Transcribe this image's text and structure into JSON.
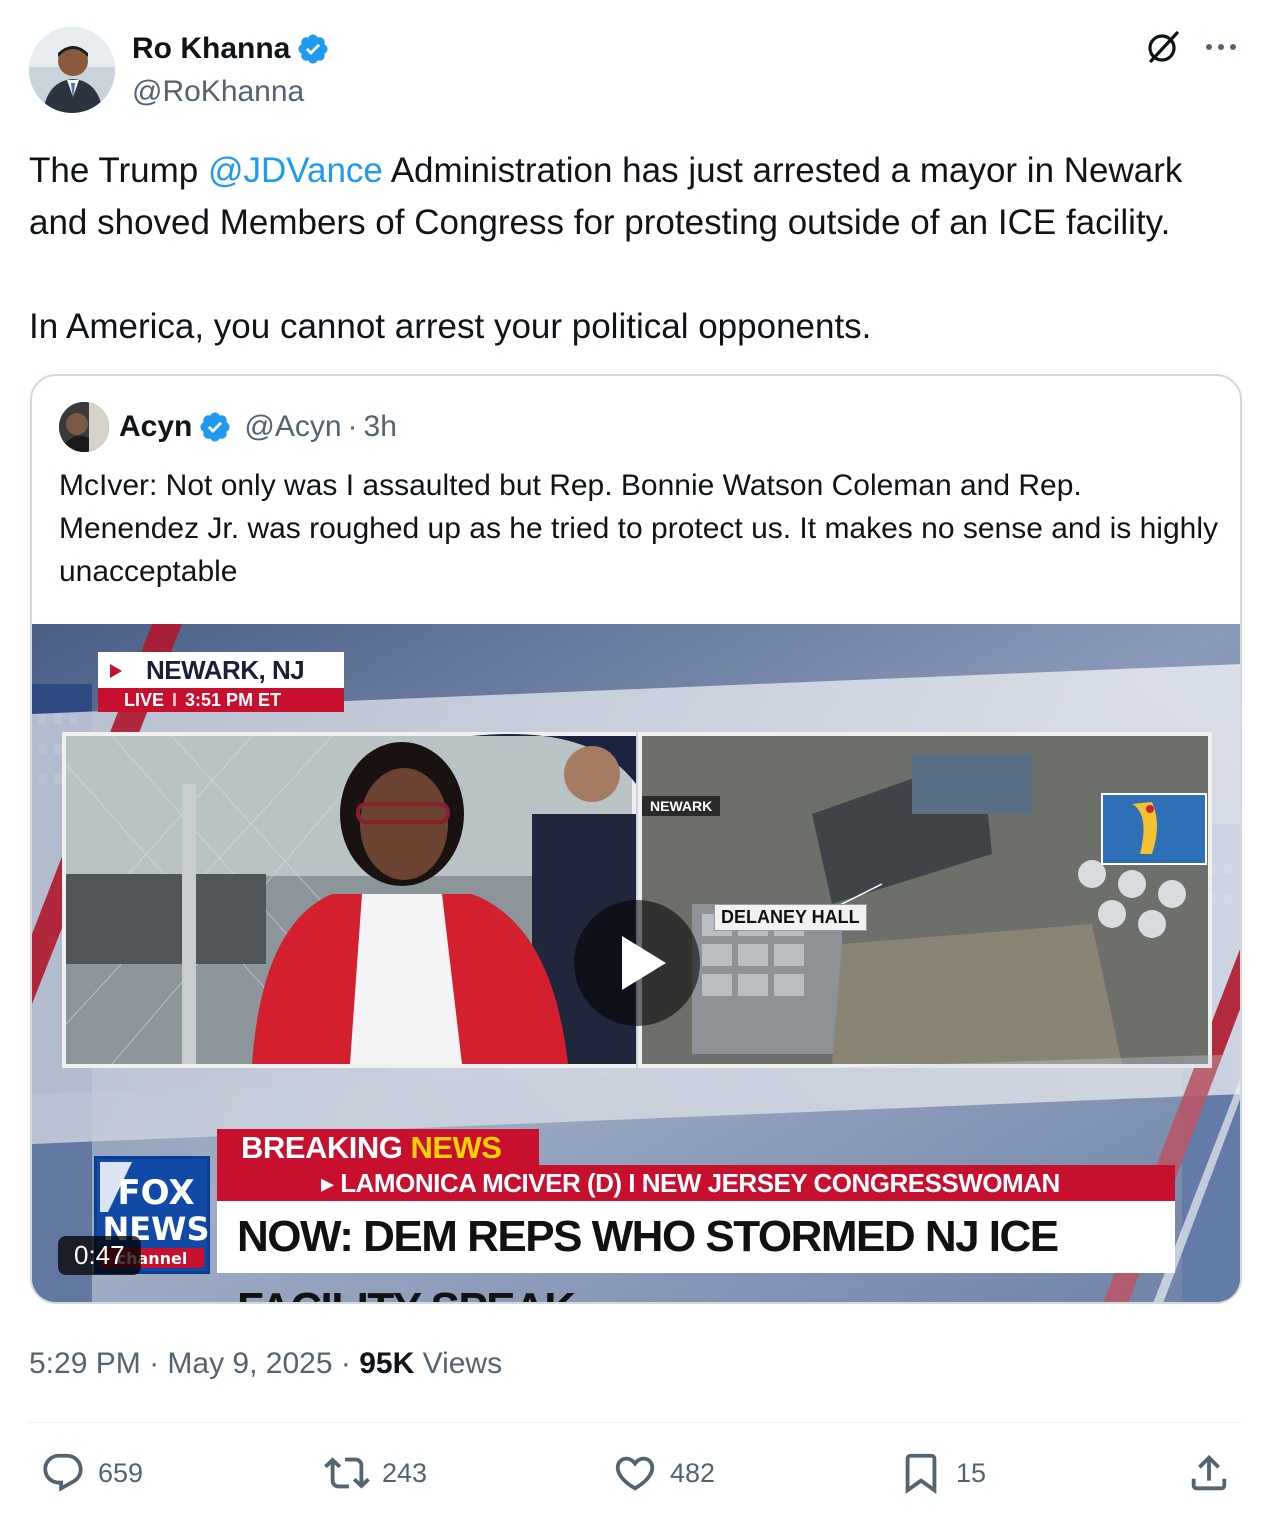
{
  "author": {
    "name": "Ro Khanna",
    "handle": "@RoKhanna",
    "verified": true
  },
  "tweet": {
    "text_before_mention": "The Trump ",
    "mention": "@JDVance",
    "text_after_mention": " Administration has just arrested a mayor in Newark and shoved Members of Congress for protesting outside of an ICE facility.",
    "text_paragraph_2": "In America, you cannot arrest your political opponents."
  },
  "quote": {
    "name": "Acyn",
    "handle": "@Acyn",
    "separator": "·",
    "time_ago": "3h",
    "text": "McIver: Not only was I assaulted but Rep. Bonnie Watson Coleman and Rep. Menendez Jr. was roughed up as he tried to protect us. It makes no sense and is highly unacceptable"
  },
  "video": {
    "location": "NEWARK, NJ",
    "live_label": "LIVE",
    "live_time": "3:51 PM ET",
    "map_label_city": "NEWARK",
    "map_label_site": "DELANEY HALL",
    "breaking_word1": "BREAKING",
    "breaking_word2": "NEWS",
    "ticker_subtitle": "▸ LAMONICA MCIVER (D) I NEW JERSEY CONGRESSWOMAN",
    "ticker_headline": "NOW: DEM REPS WHO STORMED NJ ICE FACILITY SPEAK",
    "logo_line1": "FOX",
    "logo_line2": "NEWS",
    "logo_line3": "channel",
    "duration": "0:47"
  },
  "meta": {
    "time": "5:29 PM",
    "date": "May 9, 2025",
    "separator": "·",
    "views_count": "95K",
    "views_label": "Views"
  },
  "actions": {
    "replies": "659",
    "reposts": "243",
    "likes": "482",
    "bookmarks": "15"
  },
  "colors": {
    "link": "#1d9bf0",
    "secondary_text": "#536471",
    "verified": "#1d9bf0",
    "fox_red": "#c8102e"
  },
  "icons": [
    "verified-badge-icon",
    "grok-icon",
    "more-icon",
    "play-icon",
    "reply-icon",
    "repost-icon",
    "like-icon",
    "bookmark-icon",
    "share-icon"
  ]
}
